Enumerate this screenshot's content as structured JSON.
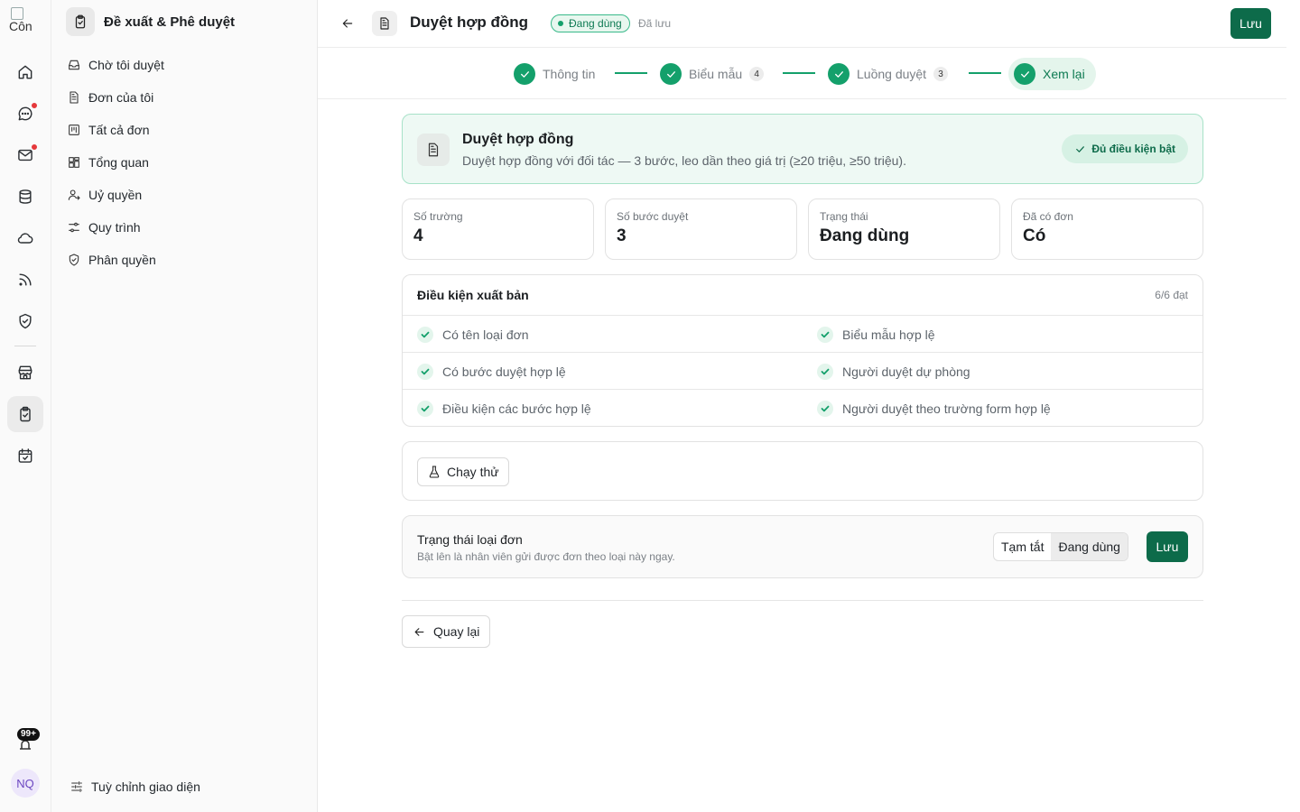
{
  "rail": {
    "logo_alt": "Côn",
    "items": [
      {
        "icon": "home-icon",
        "dot": false
      },
      {
        "icon": "chat-icon",
        "dot": true
      },
      {
        "icon": "mail-icon",
        "dot": true
      },
      {
        "icon": "database-icon",
        "dot": false
      },
      {
        "icon": "cloud-icon",
        "dot": false
      },
      {
        "icon": "rss-icon",
        "dot": false
      },
      {
        "icon": "shield-icon",
        "dot": false
      },
      {
        "icon": "store-icon",
        "dot": false
      },
      {
        "icon": "clipboard-check-icon",
        "dot": false,
        "active": true
      },
      {
        "icon": "calendar-check-icon",
        "dot": false
      }
    ],
    "notification_count": "99+",
    "avatar_initials": "NQ"
  },
  "sidebar": {
    "title": "Đề xuất & Phê duyệt",
    "items": [
      {
        "label": "Chờ tôi duyệt",
        "icon": "inbox-icon"
      },
      {
        "label": "Đơn của tôi",
        "icon": "file-icon"
      },
      {
        "label": "Tất cả đơn",
        "icon": "kanban-icon"
      },
      {
        "label": "Tổng quan",
        "icon": "dashboard-icon"
      },
      {
        "label": "Uỷ quyền",
        "icon": "user-delegate-icon"
      },
      {
        "label": "Quy trình",
        "icon": "workflow-icon"
      },
      {
        "label": "Phân quyền",
        "icon": "shield-check-icon"
      }
    ],
    "customize_label": "Tuỳ chỉnh giao diện"
  },
  "header": {
    "title": "Duyệt hợp đồng",
    "status": "Đang dùng",
    "saved": "Đã lưu",
    "save_label": "Lưu"
  },
  "steps": [
    {
      "label": "Thông tin",
      "count": ""
    },
    {
      "label": "Biểu mẫu",
      "count": "4"
    },
    {
      "label": "Luồng duyệt",
      "count": "3"
    },
    {
      "label": "Xem lại",
      "count": "",
      "active": true
    }
  ],
  "summary": {
    "title": "Duyệt hợp đồng",
    "description": "Duyệt hợp đồng với đối tác — 3 bước, leo dần theo giá trị (≥20 triệu, ≥50 triệu).",
    "badge": "Đủ điều kiện bật"
  },
  "stats": [
    {
      "label": "Số trường",
      "value": "4"
    },
    {
      "label": "Số bước duyệt",
      "value": "3"
    },
    {
      "label": "Trạng thái",
      "value": "Đang dùng"
    },
    {
      "label": "Đã có đơn",
      "value": "Có"
    }
  ],
  "checklist": {
    "title": "Điều kiện xuất bản",
    "count": "6/6 đạt",
    "rows": [
      [
        "Có tên loại đơn",
        "Biểu mẫu hợp lệ"
      ],
      [
        "Có bước duyệt hợp lệ",
        "Người duyệt dự phòng"
      ],
      [
        "Điều kiện các bước hợp lệ",
        "Người duyệt theo trường form hợp lệ"
      ]
    ]
  },
  "test": {
    "label": "Chạy thử"
  },
  "state": {
    "title": "Trạng thái loại đơn",
    "description": "Bật lên là nhân viên gửi được đơn theo loại này ngay.",
    "options": [
      "Tạm tắt",
      "Đang dùng"
    ],
    "selected": "Đang dùng",
    "save_label": "Lưu"
  },
  "footer": {
    "back_label": "Quay lại"
  },
  "colors": {
    "accent": "#0d6b4a",
    "success": "#14a06b",
    "badge_red": "#e5383b"
  }
}
